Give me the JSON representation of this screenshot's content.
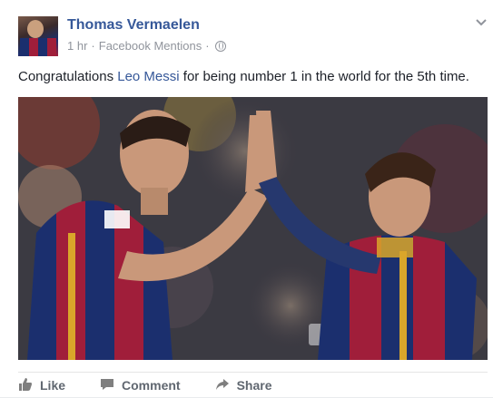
{
  "post": {
    "author": "Thomas Vermaelen",
    "time": "1 hr",
    "source": "Facebook Mentions",
    "separator": "·",
    "privacy_icon": "globe-icon",
    "options_icon": "chevron-down-icon",
    "message_prefix": "Congratulations ",
    "message_link": "Leo Messi",
    "message_suffix": " for being number 1 in the world for the 5th time."
  },
  "actions": [
    {
      "label": "Like",
      "icon": "thumbs-up-icon"
    },
    {
      "label": "Comment",
      "icon": "comment-icon"
    },
    {
      "label": "Share",
      "icon": "share-icon"
    }
  ],
  "colors": {
    "link": "#365899",
    "meta": "#90949c",
    "text": "#1d2129",
    "action": "#606770"
  }
}
